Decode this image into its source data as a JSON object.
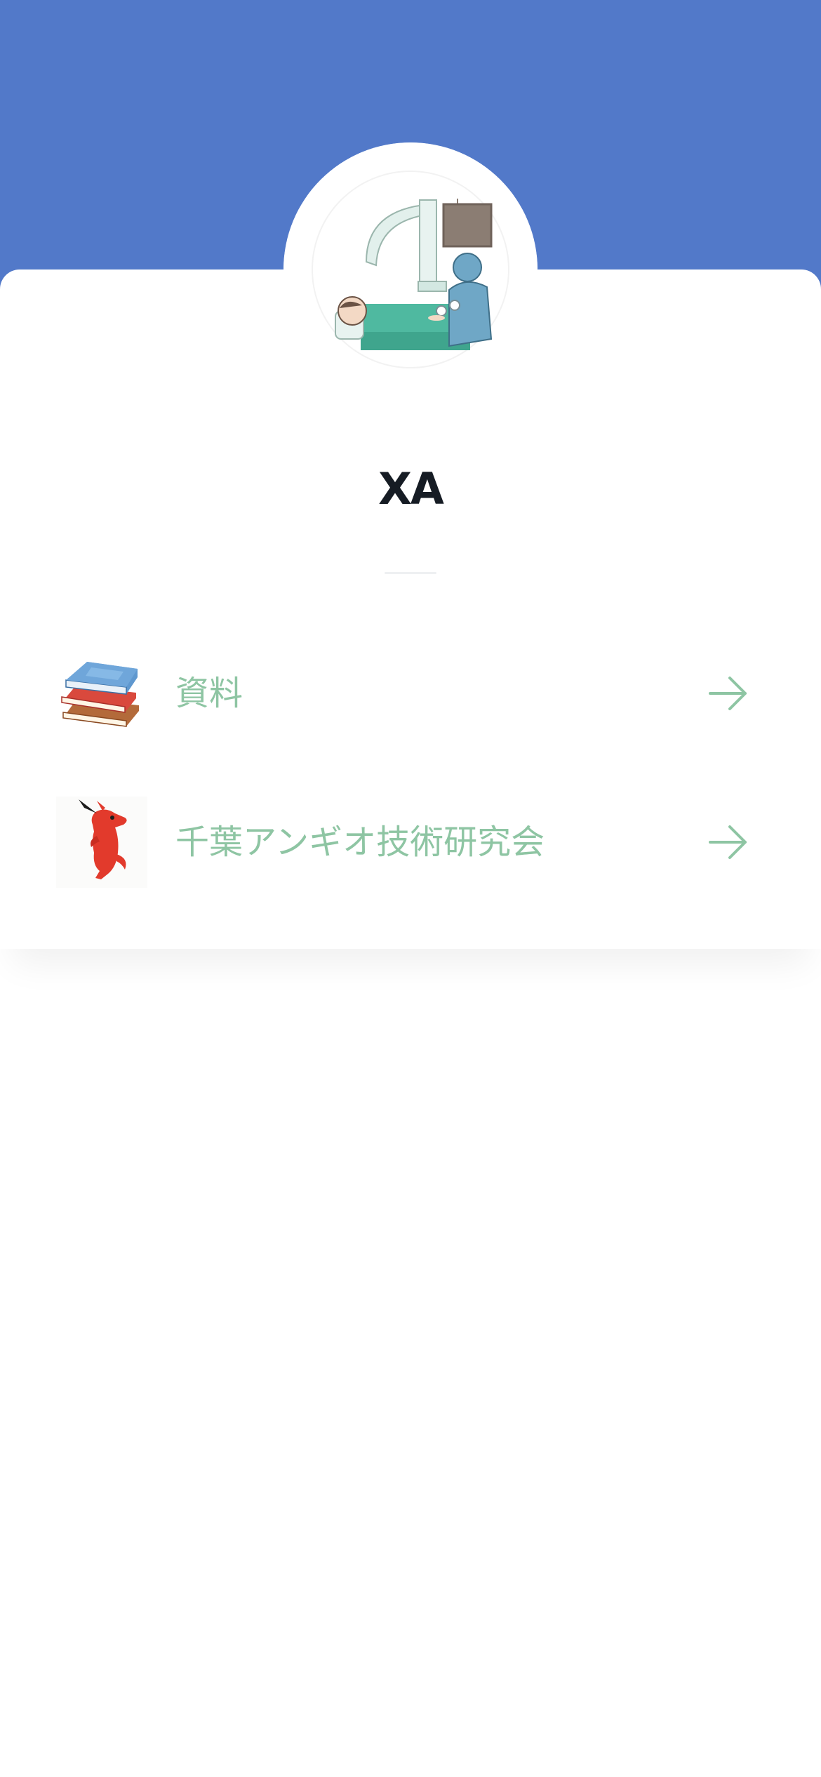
{
  "colors": {
    "header_band": "#5279c9",
    "title_text": "#161c24",
    "link_text": "#8ec5a3",
    "arrow": "#8ec5a3"
  },
  "profile": {
    "avatar_icon": "angiography-procedure-illustration",
    "title": "XA"
  },
  "links": [
    {
      "thumbnail_icon": "stack-of-books-icon",
      "label": "資料",
      "arrow_icon": "arrow-right-icon"
    },
    {
      "thumbnail_icon": "red-mascot-icon",
      "label": "千葉アンギオ技術研究会",
      "arrow_icon": "arrow-right-icon"
    }
  ]
}
